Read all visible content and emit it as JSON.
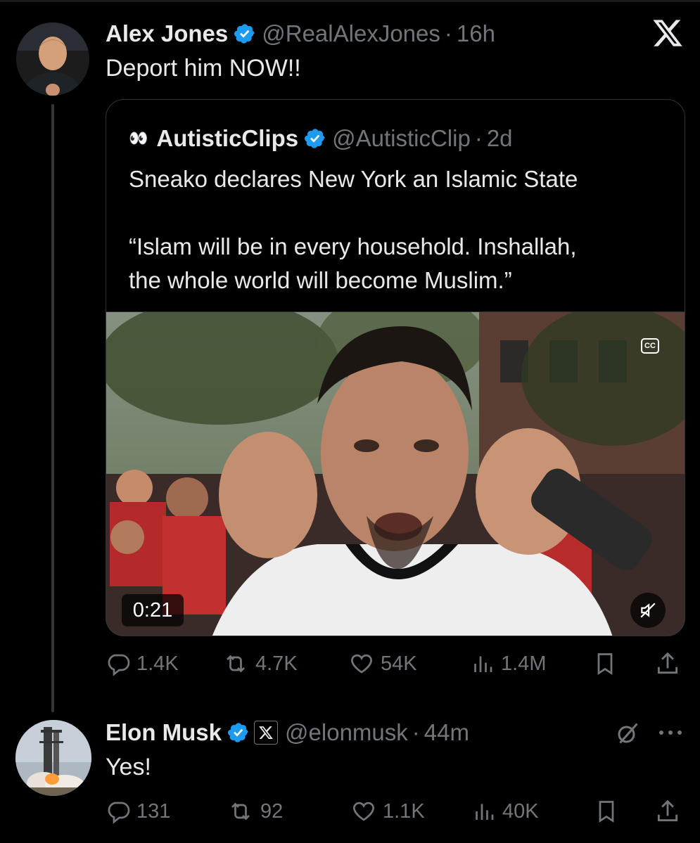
{
  "brand_colors": {
    "verified": "#1d9bf0",
    "text": "#e7e9ea",
    "muted": "#71767b",
    "border": "#2f3336"
  },
  "main_post": {
    "author_name": "Alex Jones",
    "handle": "@RealAlexJones",
    "separator": "·",
    "time": "16h",
    "text": "Deport him NOW!!"
  },
  "quoted_post": {
    "emoji": "👀",
    "author_name": "AutisticClips",
    "handle": "@AutisticClip",
    "separator": "·",
    "time": "2d",
    "text_line1": "Sneako declares New York an Islamic State",
    "text_line2": "“Islam will be in every household. Inshallah,",
    "text_line3": "the whole world will become Muslim.”",
    "video": {
      "duration": "0:21",
      "captions_label": "CC"
    }
  },
  "main_actions": {
    "replies": "1.4K",
    "reposts": "4.7K",
    "likes": "54K",
    "views": "1.4M"
  },
  "reply_post": {
    "author_name": "Elon Musk",
    "handle": "@elonmusk",
    "separator": "·",
    "time": "44m",
    "text": "Yes!"
  },
  "reply_actions": {
    "replies": "131",
    "reposts": "92",
    "likes": "1.1K",
    "views": "40K"
  },
  "icons": [
    "verified-badge-icon",
    "x-logo-icon",
    "reply-icon",
    "repost-icon",
    "like-icon",
    "views-icon",
    "bookmark-icon",
    "share-icon",
    "mute-icon",
    "captions-icon",
    "more-icon",
    "grok-icon"
  ]
}
